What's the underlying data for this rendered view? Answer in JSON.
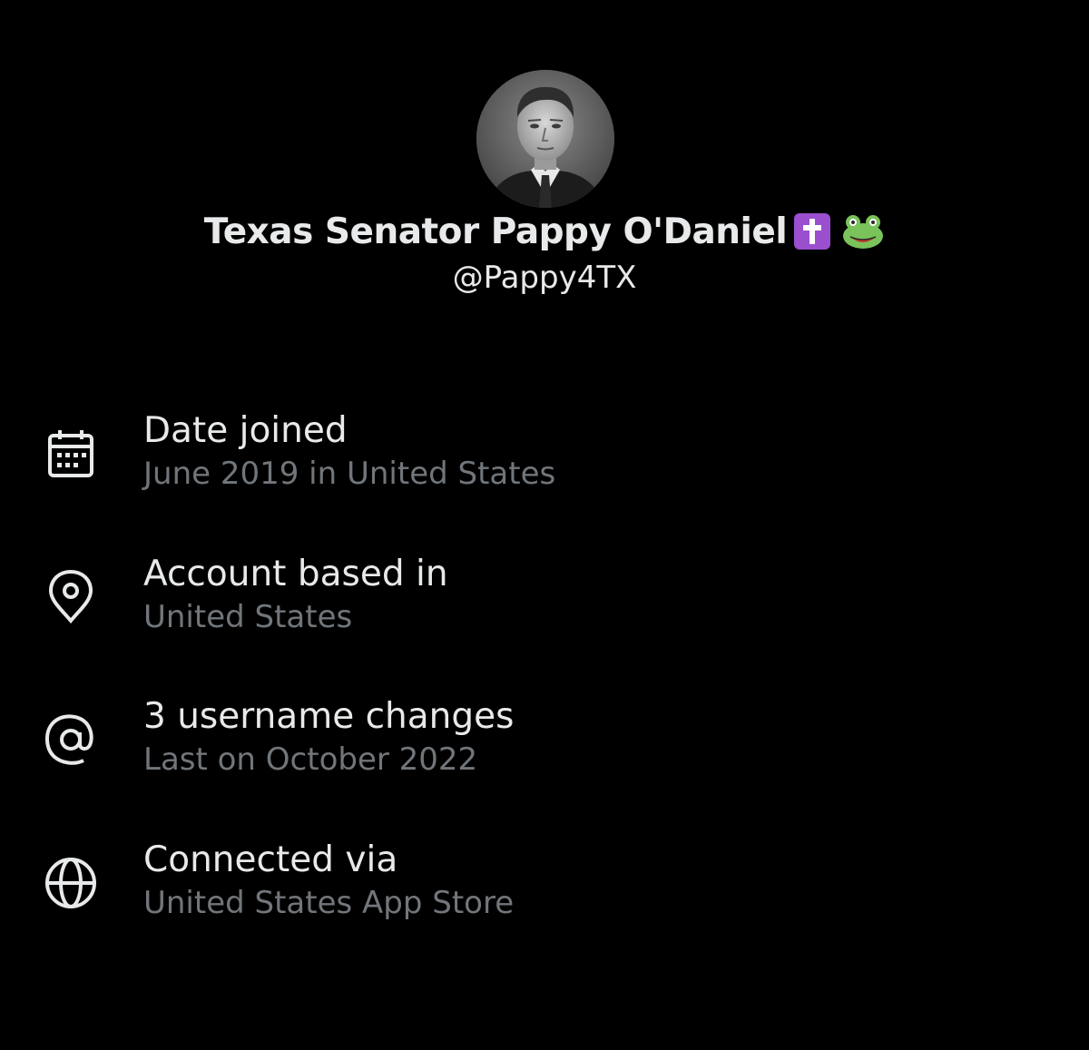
{
  "profile": {
    "display_name": "Texas Senator Pappy O'Daniel",
    "badges": [
      "latin-cross-emoji",
      "frog-face-emoji"
    ],
    "handle": "@Pappy4TX"
  },
  "about_rows": [
    {
      "icon": "calendar-icon",
      "label": "Date joined",
      "value": "June 2019 in United States"
    },
    {
      "icon": "location-pin-icon",
      "label": "Account based in",
      "value": "United States"
    },
    {
      "icon": "at-sign-icon",
      "label": "3 username changes",
      "value": "Last on October 2022"
    },
    {
      "icon": "globe-icon",
      "label": "Connected via",
      "value": "United States App Store"
    }
  ],
  "colors": {
    "background": "#000000",
    "primary_text": "#e7e9ea",
    "secondary_text": "#71767b",
    "badge_purple": "#9a4fcf",
    "frog_green": "#79c35a"
  }
}
